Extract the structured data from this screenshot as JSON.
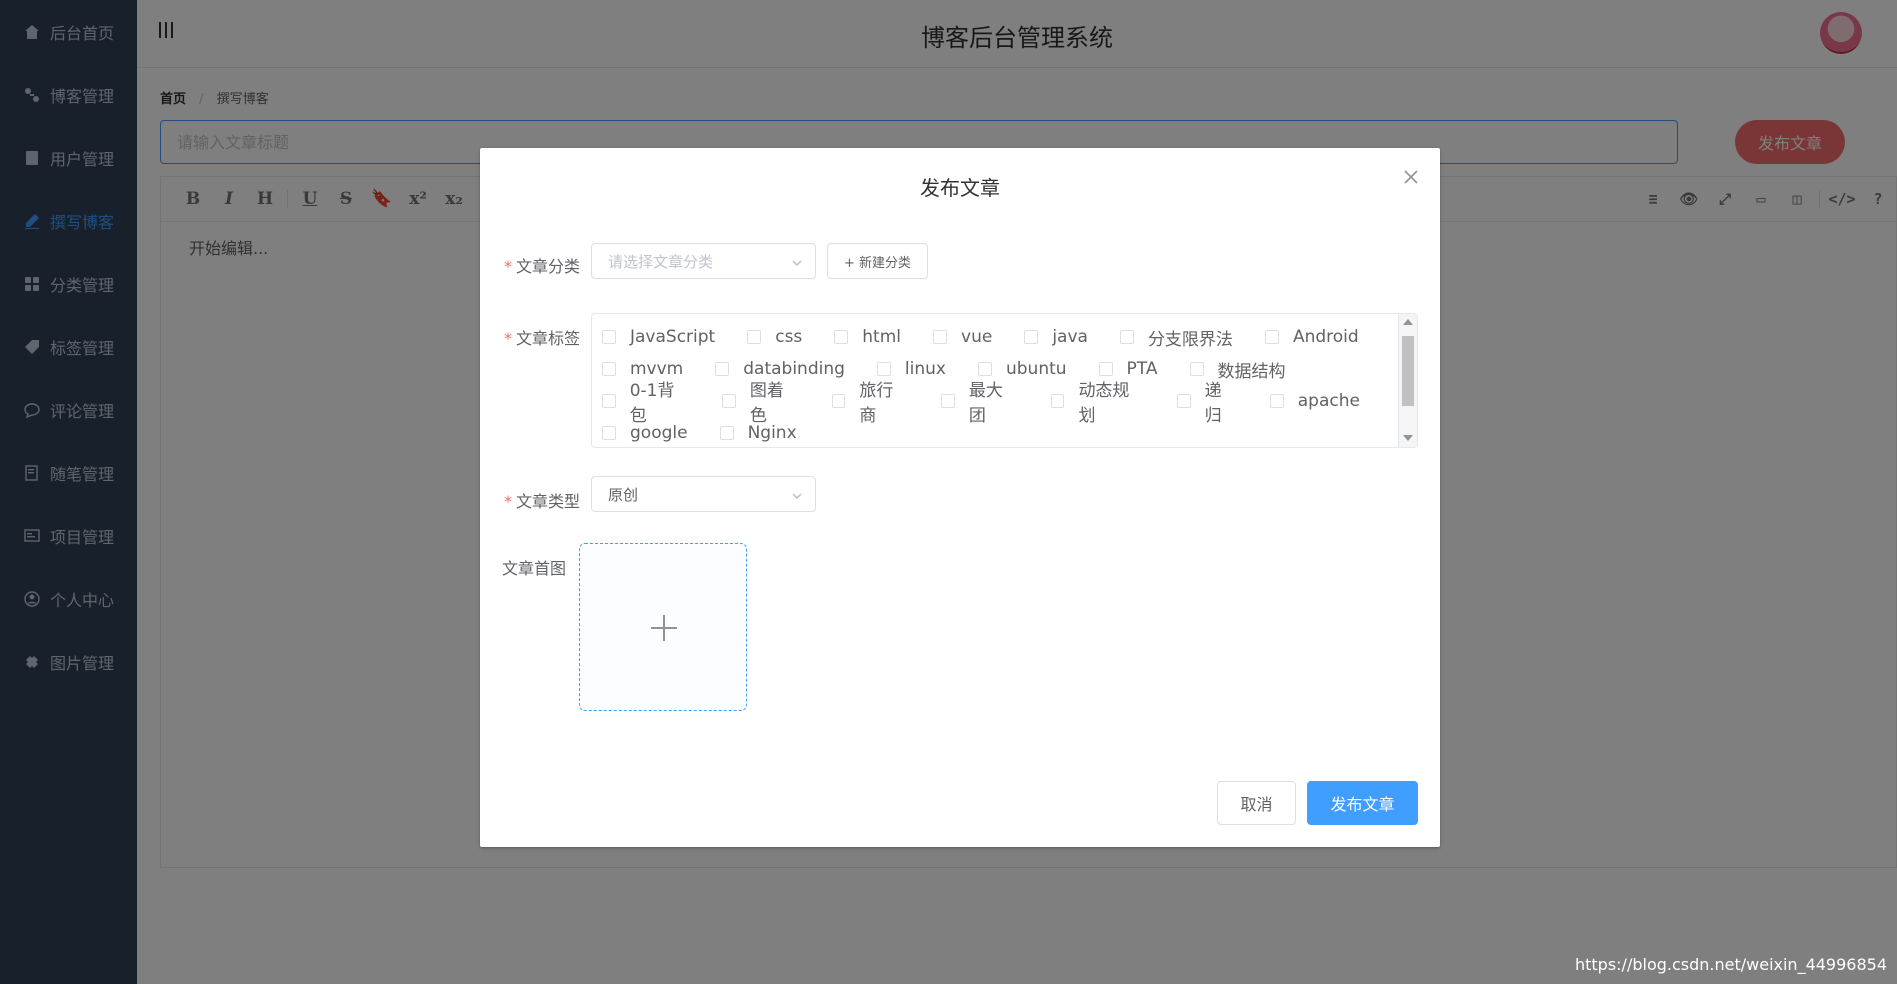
{
  "sidebar": {
    "items": [
      {
        "label": "后台首页",
        "icon": "home-icon"
      },
      {
        "label": "博客管理",
        "icon": "blog-icon"
      },
      {
        "label": "用户管理",
        "icon": "user-icon"
      },
      {
        "label": "撰写博客",
        "icon": "pen-icon",
        "active": true
      },
      {
        "label": "分类管理",
        "icon": "category-icon"
      },
      {
        "label": "标签管理",
        "icon": "tag-icon"
      },
      {
        "label": "评论管理",
        "icon": "comment-icon"
      },
      {
        "label": "随笔管理",
        "icon": "note-icon"
      },
      {
        "label": "项目管理",
        "icon": "project-icon"
      },
      {
        "label": "个人中心",
        "icon": "profile-icon"
      },
      {
        "label": "图片管理",
        "icon": "image-icon"
      }
    ]
  },
  "header": {
    "title": "博客后台管理系统"
  },
  "breadcrumb": {
    "items": [
      "首页",
      "撰写博客"
    ],
    "separator": "/"
  },
  "editor_page": {
    "title_placeholder": "请输入文章标题",
    "publish_label": "发布文章",
    "editor_placeholder": "开始编辑...",
    "toolbar_left": [
      "B",
      "I",
      "H",
      "U",
      "S",
      "🔖",
      "x²",
      "x₂"
    ],
    "toolbar_right": [
      "≡",
      "👁",
      "⤢",
      "▭",
      "◫",
      "</>",
      "?"
    ]
  },
  "dialog": {
    "title": "发布文章",
    "category": {
      "label": "文章分类",
      "placeholder": "请选择文章分类",
      "new_button": "+ 新建分类"
    },
    "tags": {
      "label": "文章标签",
      "rows": [
        [
          "JavaScript",
          "css",
          "html",
          "vue",
          "java",
          "分支限界法",
          "Android"
        ],
        [
          "mvvm",
          "databinding",
          "linux",
          "ubuntu",
          "PTA",
          "数据结构"
        ],
        [
          "0-1背包",
          "图着色",
          "旅行商",
          "最大团",
          "动态规划",
          "递归",
          "apache"
        ],
        [
          "google",
          "Nginx"
        ]
      ]
    },
    "type": {
      "label": "文章类型",
      "value": "原创"
    },
    "cover": {
      "label": "文章首图"
    },
    "cancel_label": "取消",
    "publish_label": "发布文章"
  },
  "watermark": "https://blog.csdn.net/weixin_44996854",
  "colors": {
    "sidebar_bg": "#304156",
    "primary": "#409eff",
    "danger": "#f56c6c"
  }
}
